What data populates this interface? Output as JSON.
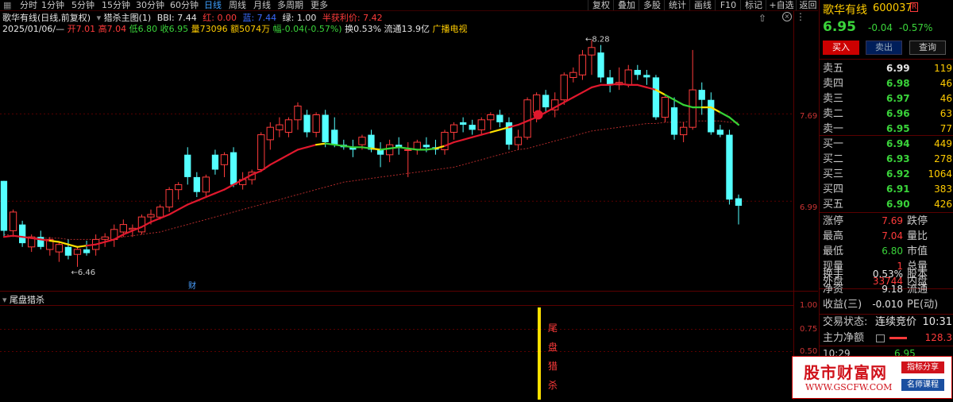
{
  "toolbar": {
    "periods": [
      "分时",
      "1分钟",
      "5分钟",
      "15分钟",
      "30分钟",
      "60分钟",
      "日线",
      "周线",
      "月线",
      "多周期",
      "更多"
    ],
    "active_period": "日线",
    "right_buttons": [
      "复权",
      "叠加",
      "多股",
      "统计",
      "画线",
      "F10",
      "标记",
      "+自选",
      "返回"
    ]
  },
  "info": {
    "title": "歌华有线(日线,前复权)",
    "indicator_name": "猎杀主图(1)",
    "bbi_label": "BBI: 7.44",
    "red_label": "红: 0.00",
    "blue_label": "蓝: 7.44",
    "green_label": "绿: 1.00",
    "profit_label": "半获利价: 7.42",
    "date": "2025/01/06/—",
    "open": "开7.01",
    "high": "高7.04",
    "low": "低6.80",
    "close": "收6.95",
    "volume": "量73096",
    "amount": "额5074万",
    "change": "幅-0.04(-0.57%)",
    "turnover": "换0.53%",
    "float": "流通13.9亿",
    "sector": "广播电视"
  },
  "chart": {
    "max_label": "8.28",
    "min_label": "6.46",
    "y_ticks": [
      "7.69",
      "6.99"
    ],
    "event_label": "财",
    "sub_title": "尾盘猎杀",
    "sub_y_ticks": [
      "1.00",
      "0.75",
      "0.50"
    ],
    "signal_chars": [
      "尾",
      "盘",
      "猎",
      "杀"
    ],
    "candles": [
      {
        "o": 7.15,
        "h": 7.15,
        "l": 6.7,
        "c": 6.75
      },
      {
        "o": 6.75,
        "h": 6.92,
        "l": 6.7,
        "c": 6.9
      },
      {
        "o": 6.8,
        "h": 6.83,
        "l": 6.62,
        "c": 6.65
      },
      {
        "o": 6.62,
        "h": 6.72,
        "l": 6.58,
        "c": 6.7
      },
      {
        "o": 6.7,
        "h": 6.75,
        "l": 6.6,
        "c": 6.62
      },
      {
        "o": 6.6,
        "h": 6.7,
        "l": 6.55,
        "c": 6.68
      },
      {
        "o": 6.58,
        "h": 6.66,
        "l": 6.5,
        "c": 6.64
      },
      {
        "o": 6.62,
        "h": 6.68,
        "l": 6.52,
        "c": 6.55
      },
      {
        "o": 6.56,
        "h": 6.62,
        "l": 6.46,
        "c": 6.6
      },
      {
        "o": 6.6,
        "h": 6.67,
        "l": 6.55,
        "c": 6.57
      },
      {
        "o": 6.6,
        "h": 6.72,
        "l": 6.55,
        "c": 6.68
      },
      {
        "o": 6.68,
        "h": 6.73,
        "l": 6.62,
        "c": 6.7
      },
      {
        "o": 6.68,
        "h": 6.8,
        "l": 6.62,
        "c": 6.76
      },
      {
        "o": 6.74,
        "h": 6.84,
        "l": 6.7,
        "c": 6.8
      },
      {
        "o": 6.76,
        "h": 6.8,
        "l": 6.7,
        "c": 6.77
      },
      {
        "o": 6.74,
        "h": 6.88,
        "l": 6.72,
        "c": 6.86
      },
      {
        "o": 6.86,
        "h": 6.92,
        "l": 6.8,
        "c": 6.88
      },
      {
        "o": 6.86,
        "h": 6.96,
        "l": 6.84,
        "c": 6.94
      },
      {
        "o": 6.94,
        "h": 7.1,
        "l": 6.9,
        "c": 7.08
      },
      {
        "o": 7.08,
        "h": 7.14,
        "l": 7.0,
        "c": 7.12
      },
      {
        "o": 7.36,
        "h": 7.42,
        "l": 7.12,
        "c": 7.18
      },
      {
        "o": 7.18,
        "h": 7.22,
        "l": 7.02,
        "c": 7.06
      },
      {
        "o": 7.06,
        "h": 7.2,
        "l": 7.02,
        "c": 7.18
      },
      {
        "o": 7.36,
        "h": 7.4,
        "l": 7.2,
        "c": 7.24
      },
      {
        "o": 7.28,
        "h": 7.38,
        "l": 7.18,
        "c": 7.36
      },
      {
        "o": 7.38,
        "h": 7.42,
        "l": 7.1,
        "c": 7.12
      },
      {
        "o": 7.12,
        "h": 7.22,
        "l": 7.08,
        "c": 7.16
      },
      {
        "o": 7.16,
        "h": 7.24,
        "l": 7.12,
        "c": 7.22
      },
      {
        "o": 7.24,
        "h": 7.54,
        "l": 7.22,
        "c": 7.52
      },
      {
        "o": 7.48,
        "h": 7.62,
        "l": 7.4,
        "c": 7.58
      },
      {
        "o": 7.56,
        "h": 7.66,
        "l": 7.5,
        "c": 7.6
      },
      {
        "o": 7.54,
        "h": 7.66,
        "l": 7.5,
        "c": 7.64
      },
      {
        "o": 7.64,
        "h": 7.78,
        "l": 7.56,
        "c": 7.75
      },
      {
        "o": 7.68,
        "h": 7.72,
        "l": 7.5,
        "c": 7.54
      },
      {
        "o": 7.54,
        "h": 7.7,
        "l": 7.5,
        "c": 7.68
      },
      {
        "o": 7.68,
        "h": 7.72,
        "l": 7.42,
        "c": 7.46
      },
      {
        "o": 7.56,
        "h": 7.66,
        "l": 7.42,
        "c": 7.44
      },
      {
        "o": 7.44,
        "h": 7.48,
        "l": 7.4,
        "c": 7.42
      },
      {
        "o": 7.42,
        "h": 7.48,
        "l": 7.34,
        "c": 7.4
      },
      {
        "o": 7.44,
        "h": 7.52,
        "l": 7.4,
        "c": 7.5
      },
      {
        "o": 7.52,
        "h": 7.56,
        "l": 7.38,
        "c": 7.4
      },
      {
        "o": 7.4,
        "h": 7.46,
        "l": 7.26,
        "c": 7.36
      },
      {
        "o": 7.36,
        "h": 7.48,
        "l": 7.3,
        "c": 7.44
      },
      {
        "o": 7.44,
        "h": 7.5,
        "l": 7.36,
        "c": 7.42
      },
      {
        "o": 7.4,
        "h": 7.46,
        "l": 7.18,
        "c": 7.4
      },
      {
        "o": 7.4,
        "h": 7.48,
        "l": 7.36,
        "c": 7.46
      },
      {
        "o": 7.44,
        "h": 7.5,
        "l": 7.38,
        "c": 7.42
      },
      {
        "o": 7.42,
        "h": 7.48,
        "l": 7.36,
        "c": 7.4
      },
      {
        "o": 7.4,
        "h": 7.56,
        "l": 7.36,
        "c": 7.54
      },
      {
        "o": 7.54,
        "h": 7.62,
        "l": 7.48,
        "c": 7.6
      },
      {
        "o": 7.62,
        "h": 7.66,
        "l": 7.54,
        "c": 7.6
      },
      {
        "o": 7.6,
        "h": 7.64,
        "l": 7.52,
        "c": 7.56
      },
      {
        "o": 7.56,
        "h": 7.66,
        "l": 7.52,
        "c": 7.64
      },
      {
        "o": 7.64,
        "h": 7.7,
        "l": 7.56,
        "c": 7.68
      },
      {
        "o": 7.68,
        "h": 7.72,
        "l": 7.58,
        "c": 7.62
      },
      {
        "o": 7.62,
        "h": 7.66,
        "l": 7.4,
        "c": 7.44
      },
      {
        "o": 7.44,
        "h": 7.56,
        "l": 7.4,
        "c": 7.5
      },
      {
        "o": 7.5,
        "h": 7.82,
        "l": 7.48,
        "c": 7.8
      },
      {
        "o": 7.7,
        "h": 7.86,
        "l": 7.62,
        "c": 7.84
      },
      {
        "o": 7.84,
        "h": 7.88,
        "l": 7.7,
        "c": 7.74
      },
      {
        "o": 7.72,
        "h": 7.86,
        "l": 7.66,
        "c": 7.8
      },
      {
        "o": 7.8,
        "h": 8.02,
        "l": 7.76,
        "c": 8.0
      },
      {
        "o": 7.98,
        "h": 8.06,
        "l": 7.94,
        "c": 8.02
      },
      {
        "o": 8.0,
        "h": 8.2,
        "l": 7.96,
        "c": 8.16
      },
      {
        "o": 8.16,
        "h": 8.28,
        "l": 8.0,
        "c": 8.22
      },
      {
        "o": 8.18,
        "h": 8.24,
        "l": 7.94,
        "c": 7.98
      },
      {
        "o": 7.98,
        "h": 8.04,
        "l": 7.86,
        "c": 7.92
      },
      {
        "o": 7.92,
        "h": 8.06,
        "l": 7.88,
        "c": 7.94
      },
      {
        "o": 7.92,
        "h": 8.08,
        "l": 7.9,
        "c": 8.04
      },
      {
        "o": 8.04,
        "h": 8.08,
        "l": 7.96,
        "c": 8.0
      },
      {
        "o": 8.0,
        "h": 8.04,
        "l": 7.92,
        "c": 7.98
      },
      {
        "o": 7.98,
        "h": 8.0,
        "l": 7.64,
        "c": 7.66
      },
      {
        "o": 7.66,
        "h": 7.84,
        "l": 7.62,
        "c": 7.82
      },
      {
        "o": 7.74,
        "h": 7.82,
        "l": 7.48,
        "c": 7.52
      },
      {
        "o": 7.52,
        "h": 7.62,
        "l": 7.46,
        "c": 7.58
      },
      {
        "o": 7.58,
        "h": 8.2,
        "l": 7.56,
        "c": 7.88
      },
      {
        "o": 7.88,
        "h": 7.94,
        "l": 7.68,
        "c": 7.8
      },
      {
        "o": 7.8,
        "h": 7.86,
        "l": 7.52,
        "c": 7.54
      },
      {
        "o": 7.56,
        "h": 7.6,
        "l": 7.5,
        "c": 7.52
      },
      {
        "o": 7.52,
        "h": 7.56,
        "l": 6.96,
        "c": 7.0
      },
      {
        "o": 7.01,
        "h": 7.04,
        "l": 6.8,
        "c": 6.95
      }
    ],
    "ma": [
      6.7,
      6.71,
      6.7,
      6.69,
      6.68,
      6.67,
      6.66,
      6.64,
      6.62,
      6.63,
      6.64,
      6.66,
      6.68,
      6.72,
      6.75,
      6.78,
      6.82,
      6.85,
      6.88,
      6.92,
      6.96,
      6.99,
      7.02,
      7.05,
      7.08,
      7.12,
      7.16,
      7.2,
      7.23,
      7.28,
      7.32,
      7.36,
      7.4,
      7.42,
      7.44,
      7.45,
      7.44,
      7.43,
      7.42,
      7.42,
      7.41,
      7.4,
      7.41,
      7.42,
      7.41,
      7.4,
      7.4,
      7.41,
      7.43,
      7.46,
      7.48,
      7.5,
      7.52,
      7.54,
      7.56,
      7.58,
      7.6,
      7.63,
      7.66,
      7.7,
      7.74,
      7.78,
      7.82,
      7.86,
      7.9,
      7.92,
      7.92,
      7.93,
      7.92,
      7.92,
      7.9,
      7.88,
      7.84,
      7.8,
      7.76,
      7.74,
      7.74,
      7.74,
      7.7,
      7.66,
      7.6
    ],
    "ma_color_segments": [
      "r",
      "r",
      "r",
      "r",
      "r",
      "y",
      "y",
      "y",
      "y",
      "r",
      "r",
      "r",
      "r",
      "r",
      "r",
      "r",
      "r",
      "r",
      "r",
      "r",
      "r",
      "r",
      "r",
      "r",
      "r",
      "r",
      "r",
      "r",
      "r",
      "r",
      "r",
      "r",
      "r",
      "r",
      "y",
      "g",
      "g",
      "g",
      "g",
      "g",
      "y",
      "g",
      "g",
      "g",
      "g",
      "g",
      "g",
      "y",
      "r",
      "r",
      "r",
      "r",
      "r",
      "y",
      "y",
      "r",
      "r",
      "r",
      "r",
      "r",
      "r",
      "r",
      "r",
      "r",
      "r",
      "r",
      "r",
      "r",
      "r",
      "r",
      "r",
      "y",
      "g",
      "g",
      "g",
      "g",
      "y",
      "y",
      "g",
      "g",
      "g"
    ],
    "ma2": [
      6.72,
      6.71,
      6.7,
      6.7,
      6.69,
      6.69,
      6.69,
      6.68,
      6.68,
      6.68,
      6.68,
      6.69,
      6.69,
      6.7,
      6.71,
      6.72,
      6.73,
      6.74,
      6.76,
      6.78,
      6.8,
      6.82,
      6.84,
      6.86,
      6.88,
      6.9,
      6.92,
      6.94,
      6.96,
      6.98,
      7.0,
      7.02,
      7.04,
      7.06,
      7.08,
      7.1,
      7.12,
      7.14,
      7.15,
      7.16,
      7.17,
      7.18,
      7.19,
      7.2,
      7.21,
      7.22,
      7.23,
      7.24,
      7.25,
      7.26,
      7.28,
      7.3,
      7.32,
      7.34,
      7.36,
      7.38,
      7.4,
      7.41,
      7.43,
      7.45,
      7.47,
      7.49,
      7.51,
      7.53,
      7.55,
      7.56,
      7.57,
      7.58,
      7.59,
      7.6,
      7.61,
      7.61,
      7.62,
      7.62,
      7.62,
      7.63,
      7.63,
      7.63,
      7.63,
      7.62,
      7.62
    ]
  },
  "quote": {
    "name": "歌华有线",
    "code": "600037",
    "tag": "R",
    "price": "6.95",
    "change": "-0.04",
    "pct": "-0.57%",
    "buy_btn": "买入",
    "sell_btn": "卖出",
    "query_btn": "查询",
    "asks": [
      {
        "label": "卖五",
        "price": "6.99",
        "vol": "119"
      },
      {
        "label": "卖四",
        "price": "6.98",
        "vol": "46"
      },
      {
        "label": "卖三",
        "price": "6.97",
        "vol": "46"
      },
      {
        "label": "卖二",
        "price": "6.96",
        "vol": "63"
      },
      {
        "label": "卖一",
        "price": "6.95",
        "vol": "77"
      }
    ],
    "bids": [
      {
        "label": "买一",
        "price": "6.94",
        "vol": "449"
      },
      {
        "label": "买二",
        "price": "6.93",
        "vol": "278"
      },
      {
        "label": "买三",
        "price": "6.92",
        "vol": "1064"
      },
      {
        "label": "买四",
        "price": "6.91",
        "vol": "383"
      },
      {
        "label": "买五",
        "price": "6.90",
        "vol": "426"
      }
    ],
    "stats": [
      {
        "k": "涨停",
        "v": "7.69",
        "vc": "red",
        "k2": "跌停"
      },
      {
        "k": "最高",
        "v": "7.04",
        "vc": "red",
        "k2": "量比"
      },
      {
        "k": "最低",
        "v": "6.80",
        "vc": "grn",
        "k2": "市值"
      },
      {
        "k": "现量",
        "v": "1",
        "vc": "red",
        "k2": "总量"
      },
      {
        "k": "外盘",
        "v": "33744",
        "vc": "red",
        "k2": "内盘"
      }
    ],
    "stats2": [
      {
        "k": "换手",
        "v": "0.53%",
        "k2": "股本"
      },
      {
        "k": "净资",
        "v": "9.18",
        "k2": "流通"
      },
      {
        "k": "收益(三)",
        "v": "-0.010",
        "k2": "PE(动)"
      }
    ],
    "trade_status_label": "交易状态:",
    "trade_status": "连续竞价",
    "trade_time": "10:31",
    "main_net_label": "主力净额",
    "main_net": "128.3",
    "last_time": "10:29",
    "last_price": "6.95"
  },
  "ad": {
    "brand": "股市财富网",
    "site": "WWW.GSCFW.COM",
    "tag1": "指标分享",
    "tag2": "名师课程"
  }
}
